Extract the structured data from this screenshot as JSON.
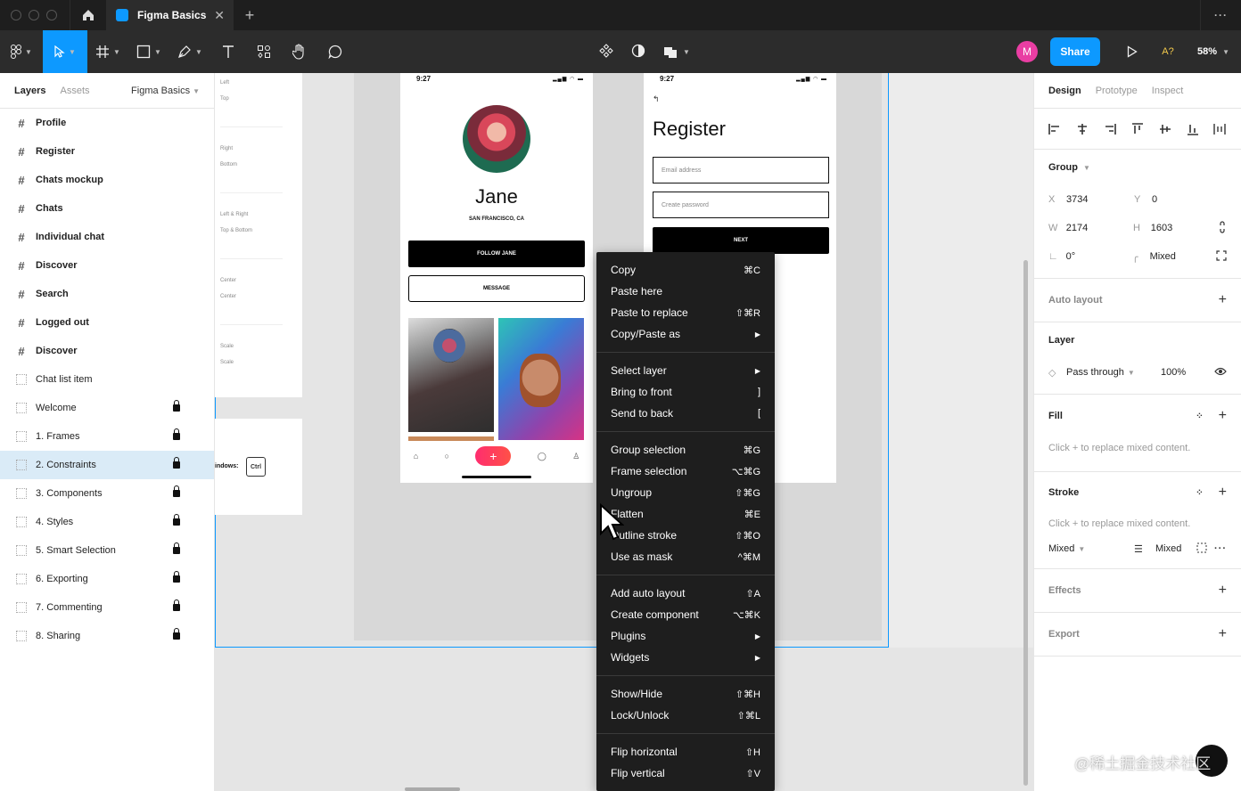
{
  "titlebar": {
    "tab_title": "Figma Basics",
    "tab_close": "✕",
    "new_tab": "+",
    "more": "···"
  },
  "toolbar": {
    "avatar_initial": "M",
    "share_label": "Share",
    "a_label": "A?",
    "zoom": "58%"
  },
  "left_panel": {
    "tabs": [
      "Layers",
      "Assets"
    ],
    "page_name": "Figma Basics",
    "layers": [
      {
        "name": "Profile",
        "type": "frame",
        "bold": true,
        "locked": false
      },
      {
        "name": "Register",
        "type": "frame",
        "bold": true,
        "locked": false
      },
      {
        "name": "Chats mockup",
        "type": "frame",
        "bold": true,
        "locked": false
      },
      {
        "name": "Chats",
        "type": "frame",
        "bold": true,
        "locked": false
      },
      {
        "name": "Individual chat",
        "type": "frame",
        "bold": true,
        "locked": false
      },
      {
        "name": "Discover",
        "type": "frame",
        "bold": true,
        "locked": false
      },
      {
        "name": "Search",
        "type": "frame",
        "bold": true,
        "locked": false
      },
      {
        "name": "Logged out",
        "type": "frame",
        "bold": true,
        "locked": false
      },
      {
        "name": "Discover",
        "type": "frame",
        "bold": true,
        "locked": false
      },
      {
        "name": "Chat list item",
        "type": "section",
        "bold": false,
        "locked": false
      },
      {
        "name": "Welcome",
        "type": "section",
        "bold": false,
        "locked": true
      },
      {
        "name": "1. Frames",
        "type": "section",
        "bold": false,
        "locked": true
      },
      {
        "name": "2. Constraints",
        "type": "section",
        "bold": false,
        "locked": true,
        "selected": true
      },
      {
        "name": "3. Components",
        "type": "section",
        "bold": false,
        "locked": true
      },
      {
        "name": "4. Styles",
        "type": "section",
        "bold": false,
        "locked": true
      },
      {
        "name": "5. Smart Selection",
        "type": "section",
        "bold": false,
        "locked": true
      },
      {
        "name": "6. Exporting",
        "type": "section",
        "bold": false,
        "locked": true
      },
      {
        "name": "7. Commenting",
        "type": "section",
        "bold": false,
        "locked": true
      },
      {
        "name": "8. Sharing",
        "type": "section",
        "bold": false,
        "locked": true
      }
    ]
  },
  "canvas": {
    "constraints": [
      {
        "a": "Left",
        "b": "Top"
      },
      {
        "a": "Right",
        "b": "Bottom"
      },
      {
        "a": "Left & Right",
        "b": "Top & Bottom"
      },
      {
        "a": "Center",
        "b": "Center"
      },
      {
        "a": "Scale",
        "b": "Scale"
      }
    ],
    "windows_text": "indows:",
    "ctrl_key": "Ctrl",
    "profile": {
      "time": "9:27",
      "name": "Jane",
      "location": "SAN FRANCISCO, CA",
      "follow_btn": "FOLLOW JANE",
      "message_btn": "MESSAGE"
    },
    "register": {
      "time": "9:27",
      "back": "↰",
      "title": "Register",
      "email_placeholder": "Email address",
      "password_placeholder": "Create password",
      "next_btn": "NEXT"
    }
  },
  "context_menu": {
    "groups": [
      [
        {
          "label": "Copy",
          "shortcut": "⌘C"
        },
        {
          "label": "Paste here",
          "shortcut": ""
        },
        {
          "label": "Paste to replace",
          "shortcut": "⇧⌘R"
        },
        {
          "label": "Copy/Paste as",
          "shortcut": "▶"
        }
      ],
      [
        {
          "label": "Select layer",
          "shortcut": "▶"
        },
        {
          "label": "Bring to front",
          "shortcut": "]"
        },
        {
          "label": "Send to back",
          "shortcut": "["
        }
      ],
      [
        {
          "label": "Group selection",
          "shortcut": "⌘G"
        },
        {
          "label": "Frame selection",
          "shortcut": "⌥⌘G"
        },
        {
          "label": "Ungroup",
          "shortcut": "⇧⌘G"
        },
        {
          "label": "Flatten",
          "shortcut": "⌘E"
        },
        {
          "label": "Outline stroke",
          "shortcut": "⇧⌘O"
        },
        {
          "label": "Use as mask",
          "shortcut": "^⌘M"
        }
      ],
      [
        {
          "label": "Add auto layout",
          "shortcut": "⇧A"
        },
        {
          "label": "Create component",
          "shortcut": "⌥⌘K"
        },
        {
          "label": "Plugins",
          "shortcut": "▶"
        },
        {
          "label": "Widgets",
          "shortcut": "▶"
        }
      ],
      [
        {
          "label": "Show/Hide",
          "shortcut": "⇧⌘H"
        },
        {
          "label": "Lock/Unlock",
          "shortcut": "⇧⌘L"
        }
      ],
      [
        {
          "label": "Flip horizontal",
          "shortcut": "⇧H"
        },
        {
          "label": "Flip vertical",
          "shortcut": "⇧V"
        }
      ]
    ]
  },
  "right_panel": {
    "tabs": {
      "design": "Design",
      "prototype": "Prototype",
      "inspect": "Inspect"
    },
    "group": {
      "title": "Group",
      "x_label": "X",
      "x": "3734",
      "y_label": "Y",
      "y": "0",
      "w_label": "W",
      "w": "2174",
      "h_label": "H",
      "h": "1603",
      "rotation": "0°",
      "radius": "Mixed"
    },
    "auto_layout": "Auto layout",
    "layer": {
      "title": "Layer",
      "blend": "Pass through",
      "opacity": "100%"
    },
    "fill": {
      "title": "Fill",
      "hint": "Click + to replace mixed content."
    },
    "stroke": {
      "title": "Stroke",
      "hint": "Click + to replace mixed content.",
      "position": "Mixed",
      "weight": "Mixed"
    },
    "effects": "Effects",
    "export": "Export"
  },
  "watermark": "@稀土掘金技术社区",
  "colors": {
    "accent": "#0d99ff",
    "selection": "#daebf7",
    "menu_bg": "#1e1e1e",
    "avatar": "#e93ea3"
  }
}
